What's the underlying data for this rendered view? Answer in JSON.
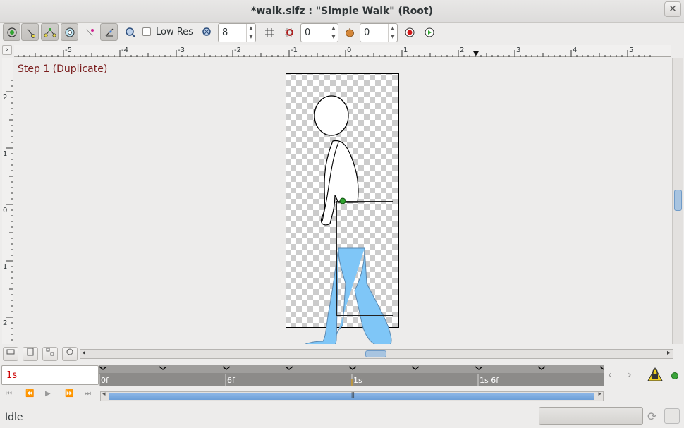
{
  "window": {
    "title": "*walk.sifz : \"Simple Walk\" (Root)"
  },
  "toolbar": {
    "low_res_label": "Low Res",
    "low_res_checked": false,
    "tools": [
      "transform-tool",
      "smooth-move-tool",
      "scale-tool",
      "rotate-tool",
      "mirror-tool",
      "draw-tool"
    ],
    "blend_value": "8",
    "onion_past": "0",
    "onion_future": "0"
  },
  "ruler": {
    "h_labels": [
      "-5",
      "-4",
      "-3",
      "-2",
      "-1",
      "0",
      "1",
      "2",
      "3",
      "4",
      "5"
    ],
    "v_labels": [
      "2",
      "1",
      "0",
      "1",
      "2"
    ]
  },
  "canvas": {
    "layer_label": "Step 1 (Duplicate)"
  },
  "timeline": {
    "current_time": "1s",
    "labels": [
      "0f",
      "6f",
      "1s",
      "1s 6f"
    ]
  },
  "status": {
    "text": "Idle"
  },
  "colors": {
    "accent": "#6d9fd8",
    "pants": "#7fc6f7",
    "label": "#7a1d1d"
  }
}
